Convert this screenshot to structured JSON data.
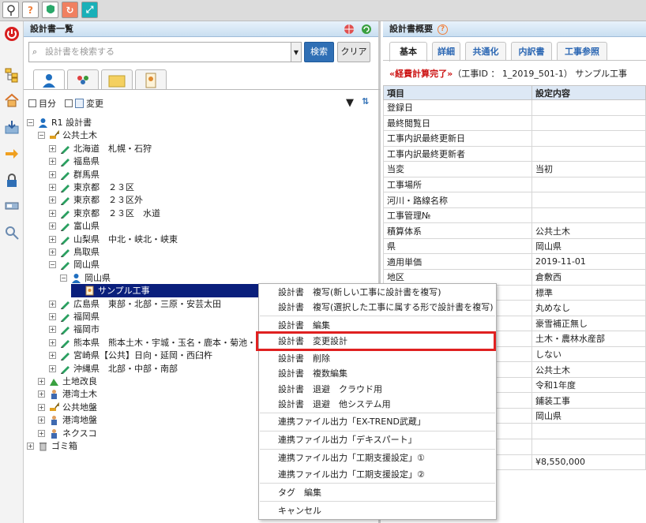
{
  "topbar": {
    "icons": [
      "location-icon",
      "help-icon",
      "shield-icon",
      "refresh-icon",
      "expand-icon"
    ]
  },
  "left_panel": {
    "title": "設計書一覧",
    "search": {
      "placeholder": "設計書を検索する",
      "button": "検索",
      "clear": "クリア"
    },
    "filters": {
      "moku": "目分",
      "henko": "変更"
    },
    "tree": [
      {
        "label": "R1 設計書",
        "level": 0,
        "exp": "-",
        "icon": "person"
      },
      {
        "label": "公共土木",
        "level": 1,
        "exp": "-",
        "icon": "excavator"
      },
      {
        "label": "北海道　札幌・石狩",
        "level": 2,
        "exp": "+",
        "icon": "pen"
      },
      {
        "label": "福島県",
        "level": 2,
        "exp": "+",
        "icon": "pen"
      },
      {
        "label": "群馬県",
        "level": 2,
        "exp": "+",
        "icon": "pen"
      },
      {
        "label": "東京都　２３区",
        "level": 2,
        "exp": "+",
        "icon": "pen"
      },
      {
        "label": "東京都　２３区外",
        "level": 2,
        "exp": "+",
        "icon": "pen"
      },
      {
        "label": "東京都　２３区　水道",
        "level": 2,
        "exp": "+",
        "icon": "pen"
      },
      {
        "label": "富山県",
        "level": 2,
        "exp": "+",
        "icon": "pen"
      },
      {
        "label": "山梨県　中北・峡北・峡東",
        "level": 2,
        "exp": "+",
        "icon": "pen"
      },
      {
        "label": "鳥取県",
        "level": 2,
        "exp": "+",
        "icon": "pen"
      },
      {
        "label": "岡山県",
        "level": 2,
        "exp": "-",
        "icon": "pen"
      },
      {
        "label": "岡山県",
        "level": 3,
        "exp": "-",
        "icon": "person"
      },
      {
        "label": "サンプル工事",
        "level": 4,
        "exp": "",
        "icon": "doc",
        "selected": true
      },
      {
        "label": "広島県　東部・北部・三原・安芸太田",
        "level": 2,
        "exp": "+",
        "icon": "pen"
      },
      {
        "label": "福岡県",
        "level": 2,
        "exp": "+",
        "icon": "pen"
      },
      {
        "label": "福岡市",
        "level": 2,
        "exp": "+",
        "icon": "pen"
      },
      {
        "label": "熊本県　熊本土木・宇城・玉名・鹿本・菊池・",
        "level": 2,
        "exp": "+",
        "icon": "pen"
      },
      {
        "label": "宮崎県【公共】日向・延岡・西臼杵",
        "level": 2,
        "exp": "+",
        "icon": "pen"
      },
      {
        "label": "沖縄県　北部・中部・南部",
        "level": 2,
        "exp": "+",
        "icon": "pen"
      },
      {
        "label": "土地改良",
        "level": 1,
        "exp": "+",
        "icon": "field"
      },
      {
        "label": "港湾土木",
        "level": 1,
        "exp": "+",
        "icon": "worker"
      },
      {
        "label": "公共地盤",
        "level": 1,
        "exp": "+",
        "icon": "excavator"
      },
      {
        "label": "港湾地盤",
        "level": 1,
        "exp": "+",
        "icon": "worker"
      },
      {
        "label": "ネクスコ",
        "level": 1,
        "exp": "+",
        "icon": "worker"
      },
      {
        "label": "ゴミ箱",
        "level": 0,
        "exp": "+",
        "icon": "trash"
      }
    ]
  },
  "right_panel": {
    "title": "設計書概要",
    "tabs": [
      "基本",
      "詳細",
      "共通化",
      "内訳書",
      "工事参照"
    ],
    "status_tag": "«経費計算完了»",
    "status_info": "（工事ID ： 1_2019_501-1） サンプル工事",
    "grid_headers": [
      "項目",
      "設定内容"
    ],
    "rows": [
      [
        "登録日",
        ""
      ],
      [
        "最終閲覧日",
        ""
      ],
      [
        "工事内訳最終更新日",
        ""
      ],
      [
        "工事内訳最終更新者",
        ""
      ],
      [
        "当変",
        "当初"
      ],
      [
        "工事場所",
        ""
      ],
      [
        "河川・路線名称",
        ""
      ],
      [
        "工事管理№",
        ""
      ],
      [
        "積算体系",
        "公共土木"
      ],
      [
        "県",
        "岡山県"
      ],
      [
        "適用単価",
        "2019-11-01"
      ],
      [
        "地区",
        "倉敷西"
      ],
      [
        "",
        "標準"
      ],
      [
        "",
        "丸めなし"
      ],
      [
        "",
        "豪雪補正無し"
      ],
      [
        "",
        "土木・農林水産部"
      ],
      [
        "",
        "しない"
      ],
      [
        "",
        "公共土木"
      ],
      [
        "",
        "令和1年度"
      ],
      [
        "",
        "鋪装工事"
      ],
      [
        "",
        "岡山県"
      ],
      [
        "",
        ""
      ],
      [
        "",
        ""
      ],
      [
        "",
        "¥8,550,000"
      ]
    ]
  },
  "context_menu": {
    "items": [
      "設計書　複写(新しい工事に設計書を複写)",
      "設計書　複写(選択した工事に属する形で設計書を複写)",
      "設計書　編集",
      "設計書　変更設計",
      "設計書　削除",
      "設計書　複数編集",
      "設計書　退避　クラウド用",
      "設計書　退避　他システム用",
      "連携ファイル出力「EX-TREND武蔵」",
      "連携ファイル出力「デキスパート」",
      "連携ファイル出力「工期支援設定」①",
      "連携ファイル出力「工期支援設定」②",
      "タグ　編集",
      "キャンセル"
    ]
  },
  "colors": {
    "selected_bg": "#0a1f7c",
    "search_btn": "#2f6fb5",
    "highlight": "#e02020",
    "status_red": "#cc1111",
    "tab_text": "#2a66b3"
  }
}
